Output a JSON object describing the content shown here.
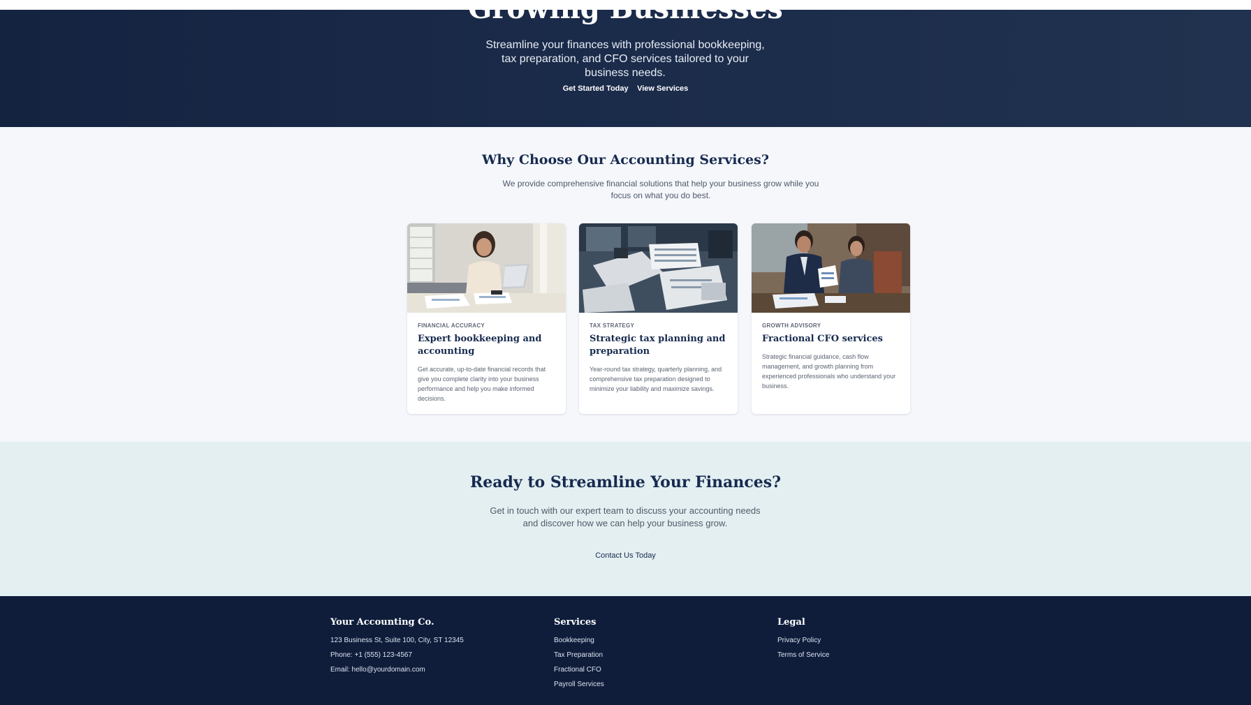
{
  "hero": {
    "title": "Growing Businesses",
    "subtitle": "Streamline your finances with professional bookkeeping, tax preparation, and CFO services tailored to your business needs.",
    "primary_cta": "Get Started Today",
    "secondary_cta": "View Services"
  },
  "why": {
    "title": "Why Choose Our Accounting Services?",
    "subtitle": "We provide comprehensive financial solutions that help your business grow while you focus on what you do best.",
    "cards": [
      {
        "tag": "FINANCIAL ACCURACY",
        "title": "Expert bookkeeping and accounting",
        "description": "Get accurate, up-to-date financial records that give you complete clarity into your business performance and help you make informed decisions.",
        "image": "woman-working-on-laptop-photo"
      },
      {
        "tag": "TAX STRATEGY",
        "title": "Strategic tax planning and preparation",
        "description": "Year-round tax strategy, quarterly planning, and comprehensive tax preparation designed to minimize your liability and maximize savings.",
        "image": "tax-documents-desk-photo"
      },
      {
        "tag": "GROWTH ADVISORY",
        "title": "Fractional CFO services",
        "description": "Strategic financial guidance, cash flow management, and growth planning from experienced professionals who understand your business.",
        "image": "advisors-meeting-photo"
      }
    ]
  },
  "cta": {
    "title": "Ready to Streamline Your Finances?",
    "subtitle": "Get in touch with our expert team to discuss your accounting needs and discover how we can help your business grow.",
    "button": "Contact Us Today"
  },
  "footer": {
    "company": {
      "name": "Your Accounting Co.",
      "address": "123 Business St, Suite 100, City, ST 12345",
      "phone": "Phone: +1 (555) 123-4567",
      "email": "Email: hello@yourdomain.com"
    },
    "services": {
      "heading": "Services",
      "links": [
        "Bookkeeping",
        "Tax Preparation",
        "Fractional CFO",
        "Payroll Services"
      ]
    },
    "legal": {
      "heading": "Legal",
      "links": [
        "Privacy Policy",
        "Terms of Service"
      ]
    }
  },
  "colors": {
    "navy": "#172a4f",
    "hero_bg": "#1b2b4a",
    "section_bg": "#f5f7fb",
    "cta_bg": "#e3eff1",
    "footer_bg": "#0f1d3b"
  }
}
